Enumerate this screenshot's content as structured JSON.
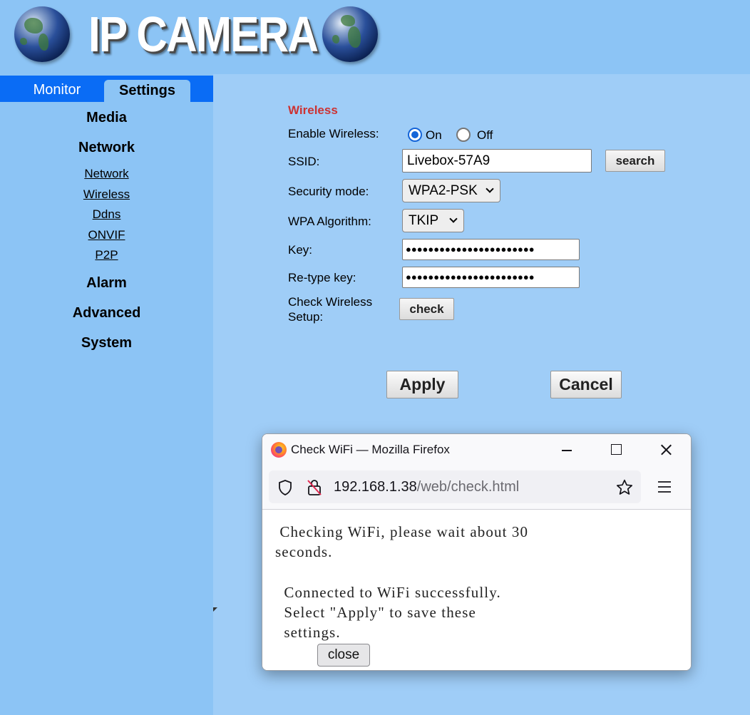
{
  "header": {
    "brand": "IP CAMERA",
    "left_icon": "globe-icon",
    "right_icon": "globe-icon"
  },
  "sidebar": {
    "tabs": [
      {
        "label": "Monitor",
        "active": false
      },
      {
        "label": "Settings",
        "active": true
      }
    ],
    "menu": {
      "media": "Media",
      "network": "Network",
      "network_items": [
        "Network",
        "Wireless",
        "Ddns",
        "ONVIF",
        "P2P"
      ],
      "alarm": "Alarm",
      "advanced": "Advanced",
      "system": "System"
    }
  },
  "form": {
    "section_title": "Wireless",
    "enable_label": "Enable Wireless:",
    "enable_on": "On",
    "enable_off": "Off",
    "enable_value": "On",
    "ssid_label": "SSID:",
    "ssid_value": "Livebox-57A9",
    "search_label": "search",
    "security_label": "Security mode:",
    "security_value": "WPA2-PSK",
    "algorithm_label": "WPA Algorithm:",
    "algorithm_value": "TKIP",
    "key_label": "Key:",
    "key_mask": "●●●●●●●●●●●●●●●●●●●●●●●",
    "retype_label": "Re-type key:",
    "retype_mask": "●●●●●●●●●●●●●●●●●●●●●●●",
    "check_label": "Check Wireless",
    "check_label2": "Setup:",
    "check_button": "check",
    "apply": "Apply",
    "cancel": "Cancel"
  },
  "popup": {
    "title": "Check WiFi — Mozilla Firefox",
    "url_host": "192.168.1.38",
    "url_path": "/web/check.html",
    "line1": " Checking WiFi, please wait about 30",
    "line2": "seconds.",
    "line3": " Connected to WiFi successfully.",
    "line4": " Select \"Apply\" to save these",
    "line5": " settings.",
    "close_button": "close"
  },
  "colors": {
    "page_bg": "#9fcdf7",
    "sidebar_bg": "#8cc4f5",
    "tabbar_bg": "#0a6cf5",
    "section_title": "#cc3333",
    "radio_accent": "#1565d8"
  }
}
